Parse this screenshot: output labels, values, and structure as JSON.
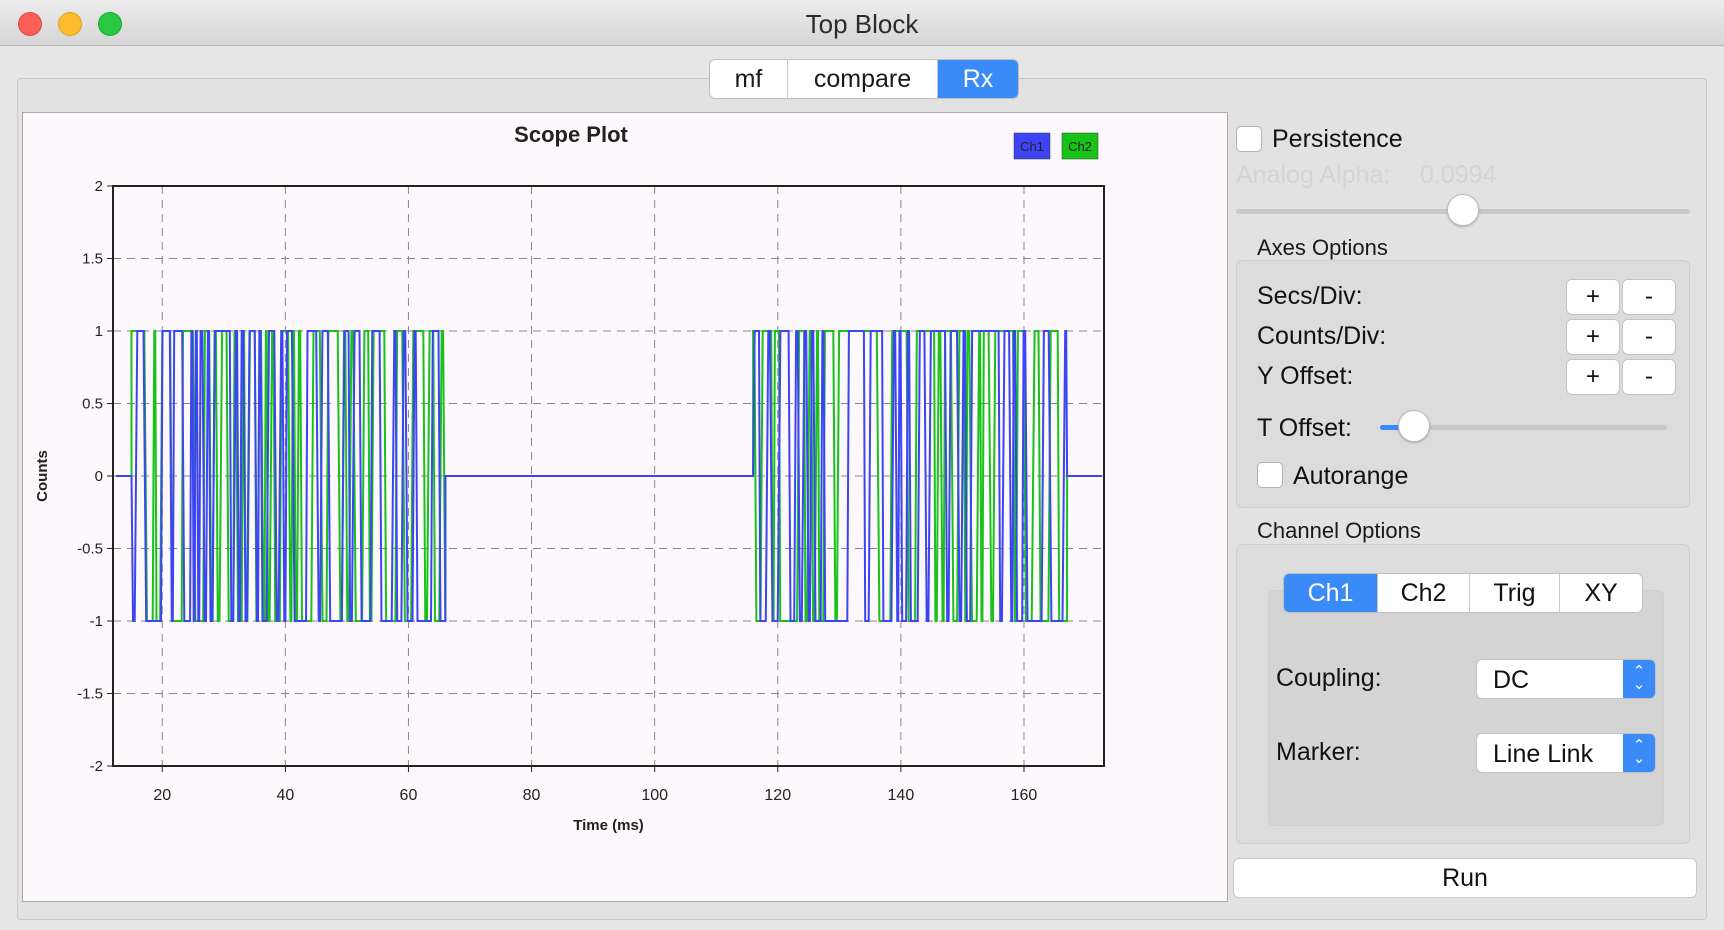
{
  "window": {
    "title": "Top Block"
  },
  "tabs": [
    {
      "label": "mf",
      "active": false
    },
    {
      "label": "compare",
      "active": false
    },
    {
      "label": "Rx",
      "active": true
    }
  ],
  "chart_data": {
    "type": "line",
    "title": "Scope Plot",
    "xlabel": "Time (ms)",
    "ylabel": "Counts",
    "xlim": [
      12,
      173
    ],
    "ylim": [
      -2,
      2
    ],
    "x_ticks": [
      "20",
      "40",
      "60",
      "80",
      "100",
      "120",
      "140",
      "160"
    ],
    "y_ticks": [
      "2",
      "1.5",
      "1",
      "0.5",
      "0",
      "-0.5",
      "-1",
      "-1.5",
      "-2"
    ],
    "grid": true,
    "legend_position": "top-right",
    "series": [
      {
        "name": "Ch1",
        "color": "#3d44f5",
        "description": "binary ±1 bursts on 15–66 ms and 116–167 ms, 0 elsewhere"
      },
      {
        "name": "Ch2",
        "color": "#19c219",
        "description": "binary ±1 bursts on 15–66 ms and 116–167 ms, 0 elsewhere"
      }
    ],
    "bursts": [
      [
        15,
        66
      ],
      [
        116,
        167
      ]
    ],
    "levels": [
      -1,
      0,
      1
    ]
  },
  "controls": {
    "persistence_label": "Persistence",
    "persistence_checked": false,
    "analog_alpha_label": "Analog Alpha:",
    "analog_alpha_value": "0.0994",
    "analog_alpha_slider": 0.5,
    "axes_options_title": "Axes Options",
    "secs_div_label": "Secs/Div:",
    "counts_div_label": "Counts/Div:",
    "y_offset_label": "Y Offset:",
    "plus": "+",
    "minus": "-",
    "t_offset_label": "T Offset:",
    "t_offset_slider": 0.12,
    "autorange_label": "Autorange",
    "autorange_checked": false,
    "channel_options_title": "Channel Options",
    "channel_tabs": [
      {
        "label": "Ch1",
        "active": true
      },
      {
        "label": "Ch2",
        "active": false
      },
      {
        "label": "Trig",
        "active": false
      },
      {
        "label": "XY",
        "active": false
      }
    ],
    "coupling_label": "Coupling:",
    "coupling_value": "DC",
    "marker_label": "Marker:",
    "marker_value": "Line Link",
    "run_label": "Run"
  },
  "icons": {
    "select_arrows": "updown-chevron-icon",
    "checkbox": "checkbox-icon"
  }
}
